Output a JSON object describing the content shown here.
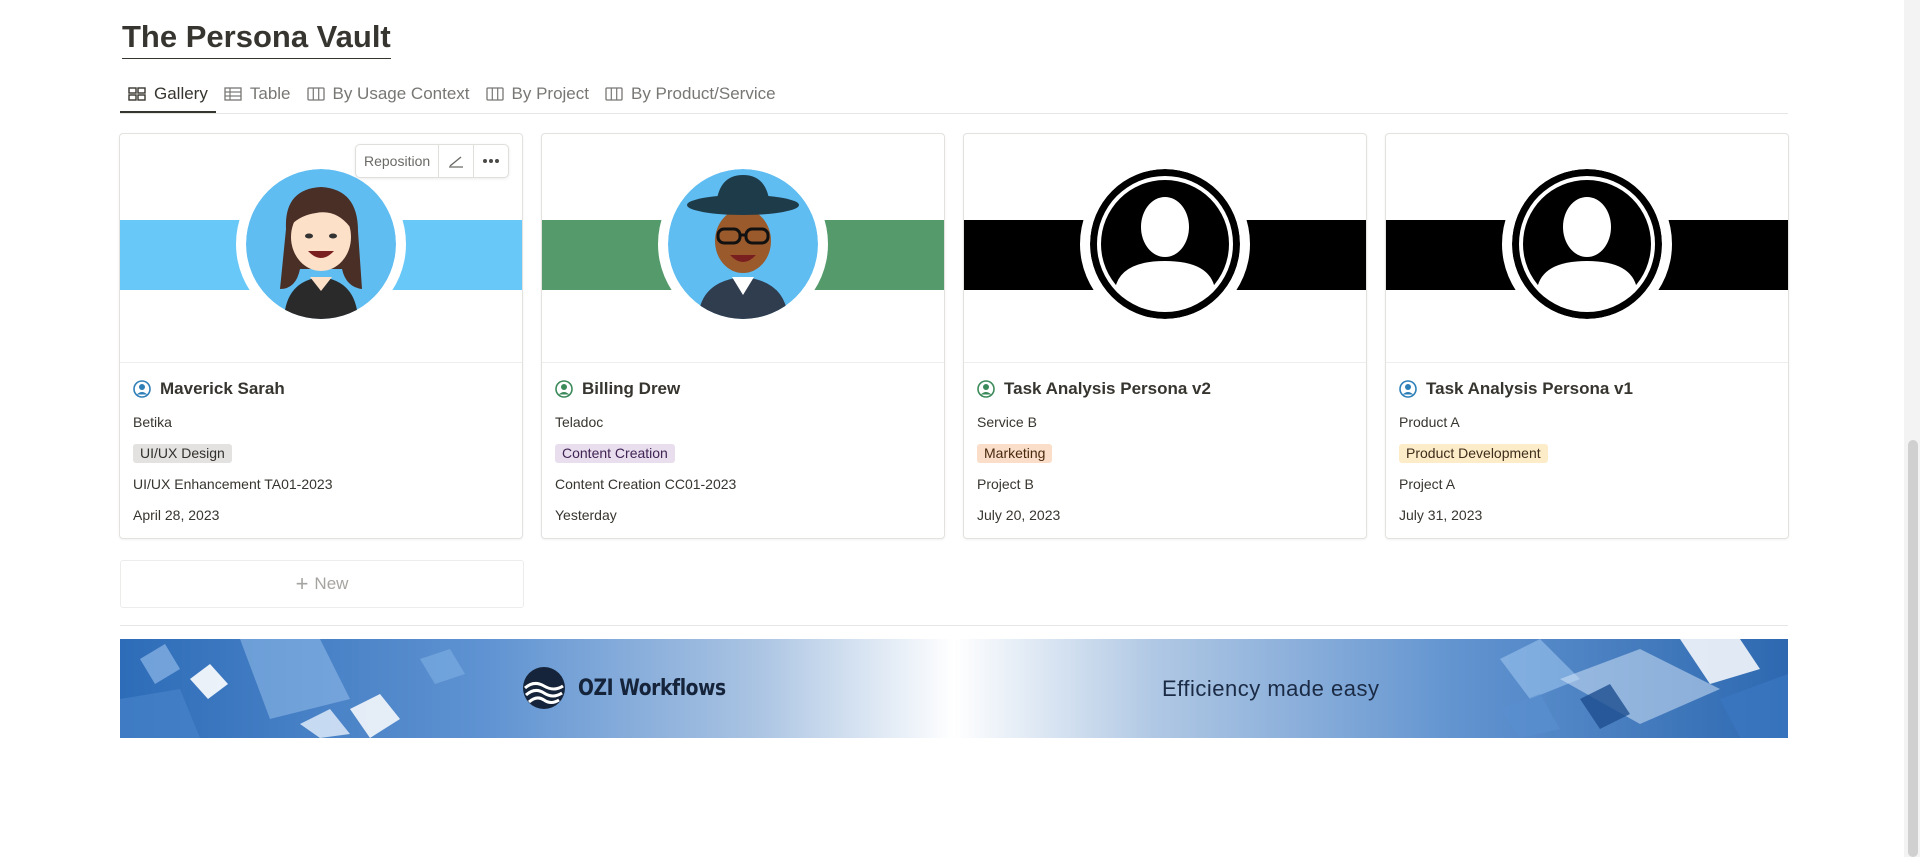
{
  "page": {
    "title": "The Persona Vault"
  },
  "tabs": [
    {
      "label": "Gallery",
      "icon": "gallery-icon",
      "active": true
    },
    {
      "label": "Table",
      "icon": "table-icon",
      "active": false
    },
    {
      "label": "By Usage Context",
      "icon": "board-icon",
      "active": false
    },
    {
      "label": "By Project",
      "icon": "board-icon",
      "active": false
    },
    {
      "label": "By Product/Service",
      "icon": "board-icon",
      "active": false
    }
  ],
  "hover_tools": {
    "reposition": "Reposition",
    "edit_icon": "pencil-icon",
    "more_icon": "more-icon"
  },
  "cards": [
    {
      "name": "Maverick Sarah",
      "company": "Betika",
      "tag": "UI/UX Design",
      "tag_bg": "#e3e2e0",
      "tag_fg": "#32302c",
      "project": "UI/UX Enhancement TA01-2023",
      "date": "April 28, 2023",
      "band_color": "#68c8f8",
      "page_icon_color": "#2e7fb8"
    },
    {
      "name": "Billing Drew",
      "company": "Teladoc",
      "tag": "Content Creation",
      "tag_bg": "#e8deee",
      "tag_fg": "#412454",
      "project": "Content Creation CC01-2023",
      "date": "Yesterday",
      "band_color": "#549a6a",
      "page_icon_color": "#3b8a5a"
    },
    {
      "name": "Task Analysis Persona v2",
      "company": "Service B",
      "tag": "Marketing",
      "tag_bg": "#fadec9",
      "tag_fg": "#49290e",
      "project": "Project B",
      "date": "July 20, 2023",
      "band_color": "#000000",
      "page_icon_color": "#3b8a5a"
    },
    {
      "name": "Task Analysis Persona v1",
      "company": "Product A",
      "tag": "Product Development",
      "tag_bg": "#fdecc8",
      "tag_fg": "#402c1b",
      "project": "Project A",
      "date": "July 31, 2023",
      "band_color": "#000000",
      "page_icon_color": "#2e7fb8"
    }
  ],
  "new_button": {
    "label": "New"
  },
  "banner": {
    "brand": "OZI Workflows",
    "tagline": "Efficiency made easy"
  }
}
